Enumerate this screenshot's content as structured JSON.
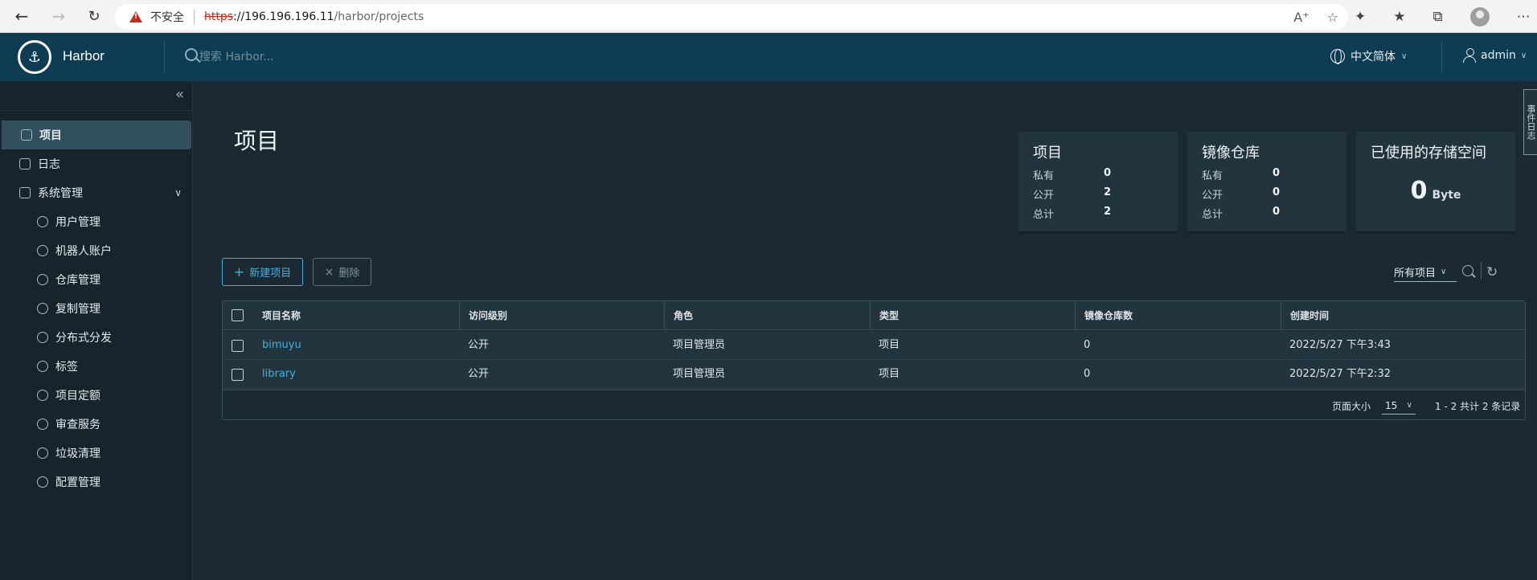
{
  "browser": {
    "insecure_label": "不安全",
    "url_protocol": "https",
    "url_host": "://196.196.196.11",
    "url_path": "/harbor/projects"
  },
  "header": {
    "brand": "Harbor",
    "search_placeholder": "搜索 Harbor...",
    "language": "中文简体",
    "user": "admin"
  },
  "sidebar": {
    "items": [
      {
        "label": "项目",
        "icon": "projects-icon"
      },
      {
        "label": "日志",
        "icon": "logs-icon"
      },
      {
        "label": "系统管理",
        "icon": "admin-icon"
      },
      {
        "label": "用户管理",
        "icon": "users-icon"
      },
      {
        "label": "机器人账户",
        "icon": "robot-icon"
      },
      {
        "label": "仓库管理",
        "icon": "registry-icon"
      },
      {
        "label": "复制管理",
        "icon": "replication-icon"
      },
      {
        "label": "分布式分发",
        "icon": "distribution-icon"
      },
      {
        "label": "标签",
        "icon": "tag-icon"
      },
      {
        "label": "项目定额",
        "icon": "quota-icon"
      },
      {
        "label": "审查服务",
        "icon": "shield-icon"
      },
      {
        "label": "垃圾清理",
        "icon": "trash-icon"
      },
      {
        "label": "配置管理",
        "icon": "gear-icon"
      }
    ]
  },
  "page": {
    "title": "项目"
  },
  "stats": {
    "projects": {
      "title": "项目",
      "private_label": "私有",
      "private": "0",
      "public_label": "公开",
      "public": "2",
      "total_label": "总计",
      "total": "2"
    },
    "repos": {
      "title": "镜像仓库",
      "private_label": "私有",
      "private": "0",
      "public_label": "公开",
      "public": "0",
      "total_label": "总计",
      "total": "0"
    },
    "storage": {
      "title": "已使用的存储空间",
      "value": "0",
      "unit": "Byte"
    }
  },
  "toolbar": {
    "new_label": "新建项目",
    "delete_label": "删除",
    "filter": "所有项目"
  },
  "table": {
    "columns": [
      "项目名称",
      "访问级别",
      "角色",
      "类型",
      "镜像仓库数",
      "创建时间"
    ],
    "rows": [
      [
        "bimuyu",
        "公开",
        "项目管理员",
        "项目",
        "0",
        "2022/5/27 下午3:43"
      ],
      [
        "library",
        "公开",
        "项目管理员",
        "项目",
        "0",
        "2022/5/27 下午2:32"
      ]
    ],
    "page_size_label": "页面大小",
    "page_size": "15",
    "count": "1 - 2 共计 2 条记录"
  },
  "event_tab": "事件日志",
  "colors": {
    "header": "#0d3c53",
    "sidebar": "#17242b",
    "content": "#1b2a32",
    "accent": "#4aaed9"
  }
}
